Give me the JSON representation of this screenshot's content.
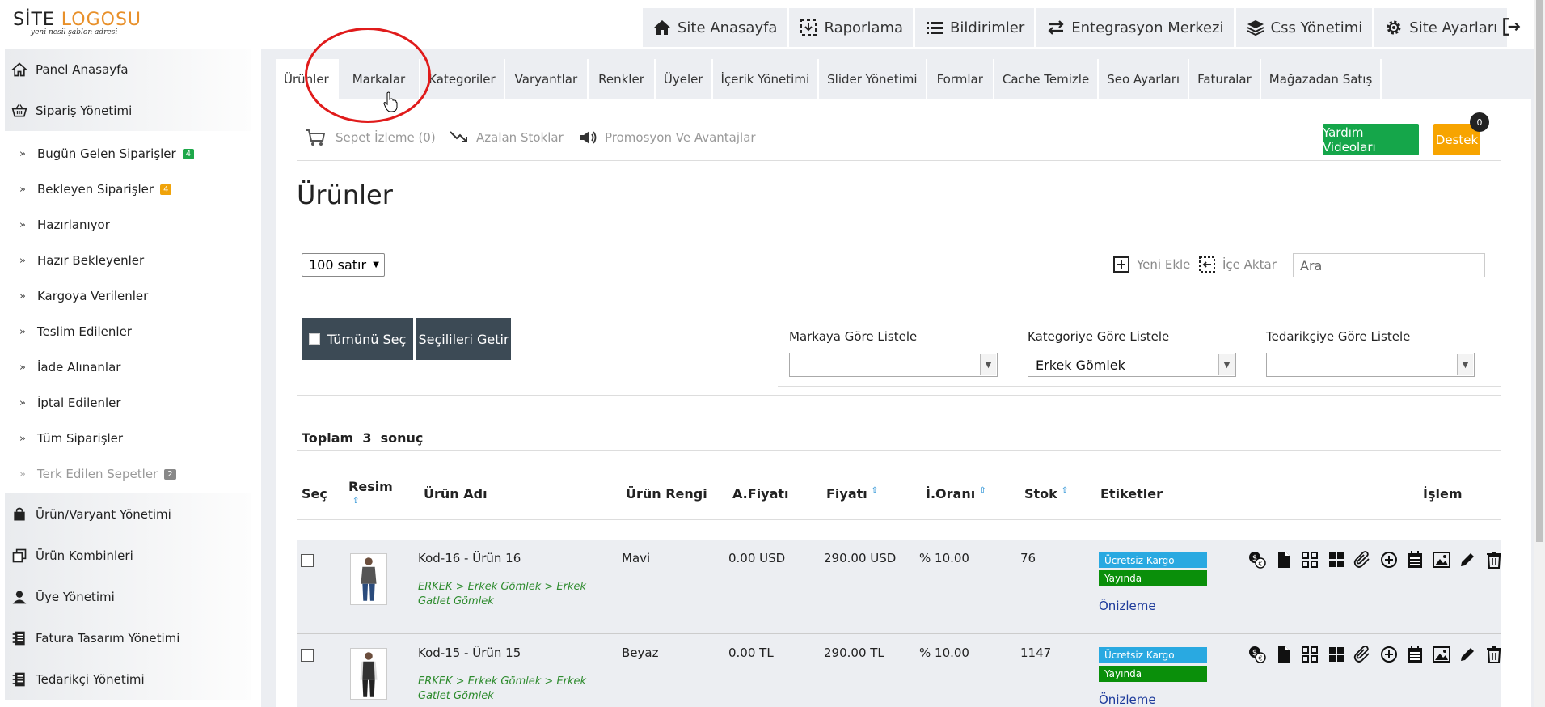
{
  "logo": {
    "line1_a": "SİTE ",
    "line1_b": "LOGOSU",
    "tagline": "yeni nesil şablon adresi"
  },
  "topnav": [
    {
      "label": "Site Anasayfa",
      "icon": "home-icon"
    },
    {
      "label": "Raporlama",
      "icon": "download-icon"
    },
    {
      "label": "Bildirimler",
      "icon": "list-icon"
    },
    {
      "label": "Entegrasyon Merkezi",
      "icon": "swap-icon"
    },
    {
      "label": "Css Yönetimi",
      "icon": "layers-icon"
    },
    {
      "label": "Site Ayarları",
      "icon": "gear-icon"
    }
  ],
  "sidebar": {
    "panel": "Panel Anasayfa",
    "orders": "Sipariş Yönetimi",
    "sub": [
      {
        "label": "Bugün Gelen Siparişler",
        "badge": "4",
        "badge_color": "#1ea84a"
      },
      {
        "label": "Bekleyen Siparişler",
        "badge": "4",
        "badge_color": "#f0a30a"
      },
      {
        "label": "Hazırlanıyor"
      },
      {
        "label": "Hazır Bekleyenler"
      },
      {
        "label": "Kargoya Verilenler"
      },
      {
        "label": "Teslim Edilenler"
      },
      {
        "label": "İade Alınanlar"
      },
      {
        "label": "İptal Edilenler"
      },
      {
        "label": "Tüm Siparişler"
      },
      {
        "label": "Terk Edilen Sepetler",
        "badge": "2",
        "badge_color": "#888888"
      }
    ],
    "product": "Ürün/Varyant Yönetimi",
    "combos": "Ürün Kombinleri",
    "members": "Üye Yönetimi",
    "invoice": "Fatura Tasarım Yönetimi",
    "supplier": "Tedarikçi Yönetimi"
  },
  "tabs": [
    "Ürünler",
    "Markalar",
    "Kategoriler",
    "Varyantlar",
    "Renkler",
    "Üyeler",
    "İçerik Yönetimi",
    "Slider Yönetimi",
    "Formlar",
    "Cache Temizle",
    "Seo Ayarları",
    "Faturalar",
    "Mağazadan Satış"
  ],
  "subtools": {
    "cart": "Sepet İzleme (0)",
    "low_stock": "Azalan Stoklar",
    "promo": "Promosyon Ve Avantajlar"
  },
  "help_button": "Yardım Videoları",
  "support_button": "Destek",
  "support_count": "0",
  "page_title": "Ürünler",
  "rows_select": "100 satır",
  "add_new": "Yeni Ekle",
  "import": "İçe Aktar",
  "search_placeholder": "Ara",
  "select_all": "Tümünü Seç",
  "fetch_selected": "Seçilileri Getir",
  "filters": {
    "brand_label": "Markaya Göre Listele",
    "brand_value": "",
    "category_label": "Kategoriye Göre Listele",
    "category_value": "Erkek Gömlek",
    "supplier_label": "Tedarikçiye Göre Listele",
    "supplier_value": ""
  },
  "total": {
    "prefix": "Toplam",
    "count": "3",
    "suffix": "sonuç"
  },
  "columns": [
    "Seç",
    "Resim",
    "Ürün Adı",
    "Ürün Rengi",
    "A.Fiyatı",
    "Fiyatı",
    "İ.Oranı",
    "Stok",
    "Etiketler",
    "İşlem"
  ],
  "products": [
    {
      "name": "Kod-16 - Ürün 16",
      "crumb": "ERKEK > Erkek Gömlek > Erkek Gatlet Gömlek",
      "color": "Mavi",
      "buy_price": "0.00 USD",
      "price": "290.00 USD",
      "rate": "% 10.00",
      "stock": "76",
      "tag1": "Ücretsiz Kargo",
      "tag2": "Yayında",
      "preview": "Önizleme"
    },
    {
      "name": "Kod-15 - Ürün 15",
      "crumb": "ERKEK > Erkek Gömlek > Erkek Gatlet Gömlek",
      "color": "Beyaz",
      "buy_price": "0.00 TL",
      "price": "290.00 TL",
      "rate": "% 10.00",
      "stock": "1147",
      "tag1": "Ücretsiz Kargo",
      "tag2": "Yayında",
      "preview": "Önizleme"
    }
  ],
  "action_icons": [
    "currency-icon",
    "file-icon",
    "grid-icon",
    "tiles-icon",
    "paperclip-icon",
    "plus-circle-icon",
    "calendar-icon",
    "image-icon",
    "pencil-icon",
    "trash-icon"
  ]
}
